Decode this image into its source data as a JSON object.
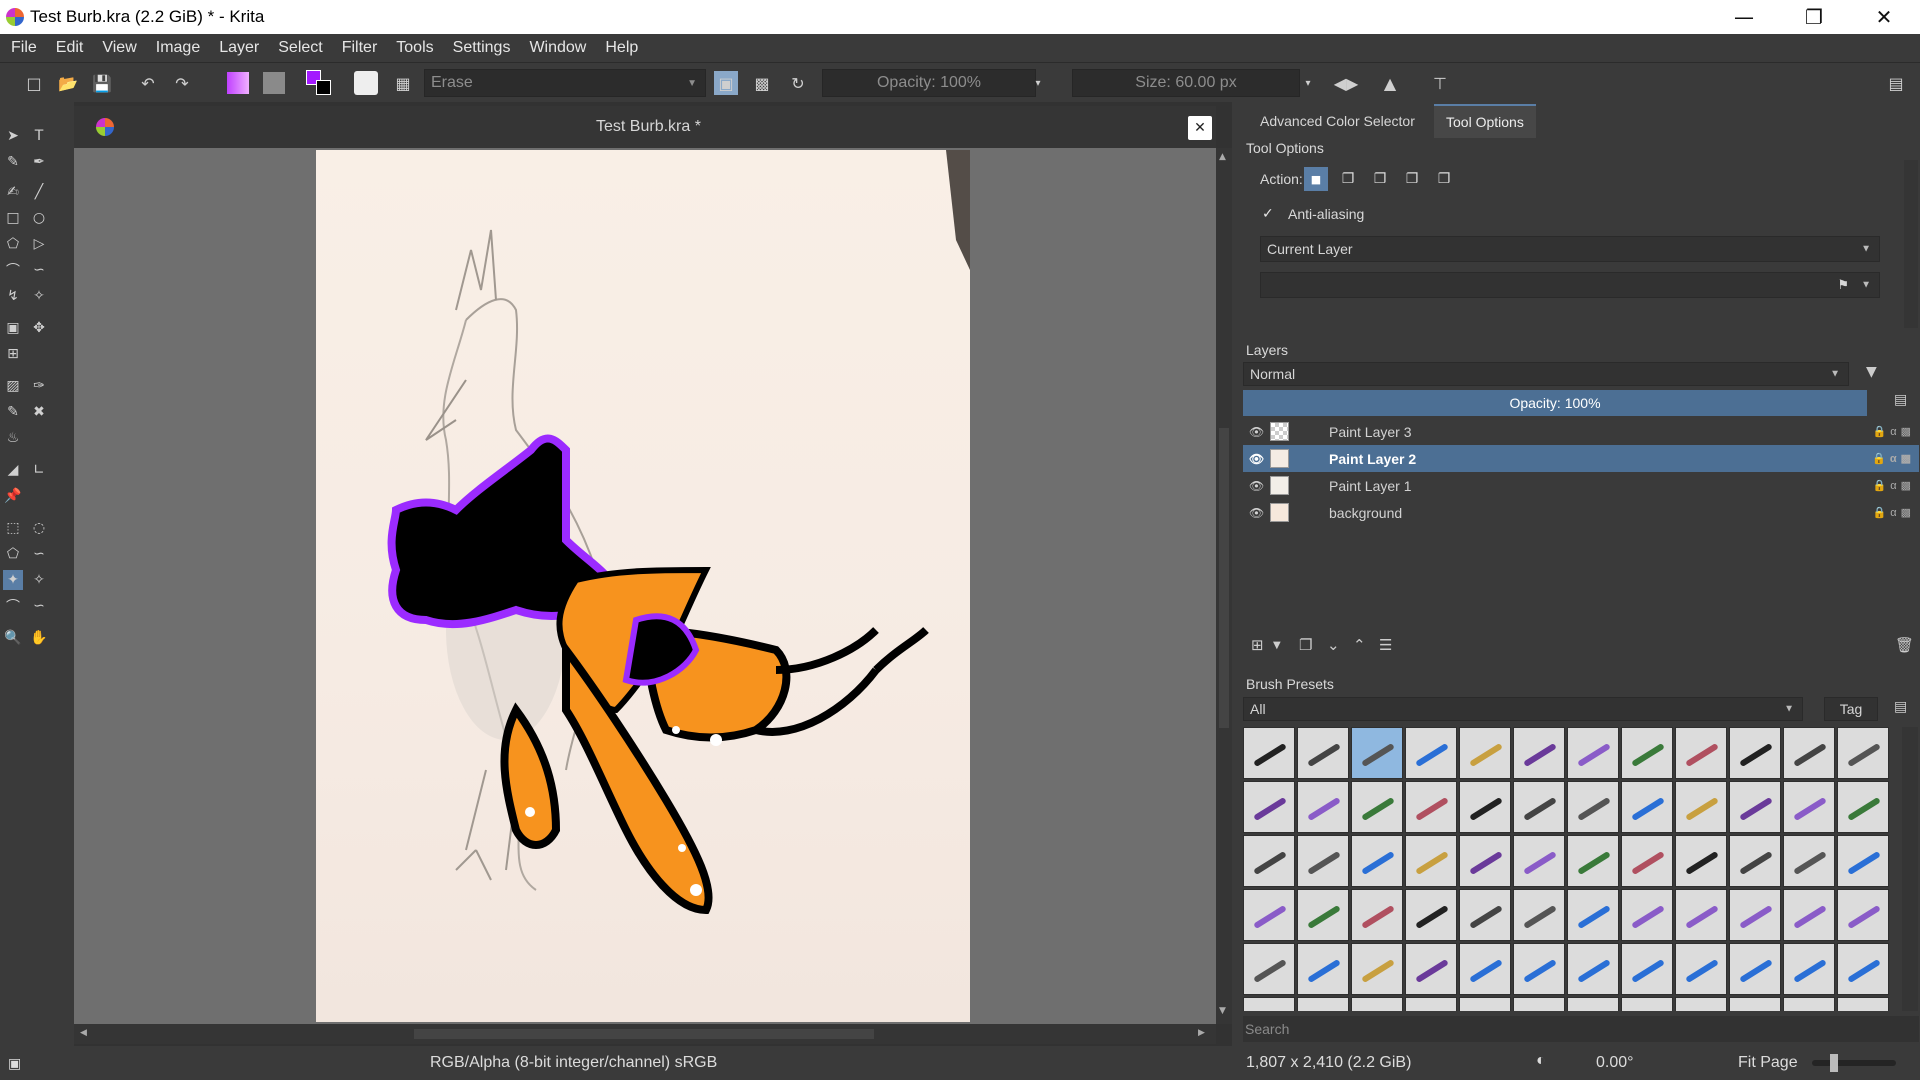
{
  "window": {
    "title": "Test Burb.kra (2.2 GiB)  * - Krita"
  },
  "menu": [
    "File",
    "Edit",
    "View",
    "Image",
    "Layer",
    "Select",
    "Filter",
    "Tools",
    "Settings",
    "Window",
    "Help"
  ],
  "toolbar": {
    "brush_preset_placeholder": "Erase",
    "opacity": "Opacity: 100%",
    "size": "Size: 60.00 px"
  },
  "document": {
    "tab_title": "Test Burb.kra *"
  },
  "dock": {
    "tabs": [
      "Advanced Color Selector",
      "Tool Options"
    ],
    "tool_options": {
      "title": "Tool Options",
      "action_label": "Action:",
      "antialias_label": "Anti-aliasing",
      "source_combo": "Current Layer"
    },
    "layers": {
      "title": "Layers",
      "blend_mode": "Normal",
      "opacity": "Opacity:  100%",
      "items": [
        {
          "name": "Paint Layer 3",
          "selected": false
        },
        {
          "name": "Paint Layer 2",
          "selected": true
        },
        {
          "name": "Paint Layer 1",
          "selected": false
        },
        {
          "name": "background",
          "selected": false
        }
      ]
    },
    "brush_presets": {
      "title": "Brush Presets",
      "filter": "All",
      "tag_button": "Tag",
      "search_placeholder": "Search"
    }
  },
  "status": {
    "color_profile": "RGB/Alpha (8-bit integer/channel)  sRGB",
    "dimensions": "1,807 x 2,410 (2.2 GiB)",
    "rotation": "0.00°",
    "zoom_mode": "Fit Page"
  },
  "colors": {
    "selection": "#9b2bff",
    "orange": "#f7931e",
    "selected_layer": "#4c6f94"
  }
}
